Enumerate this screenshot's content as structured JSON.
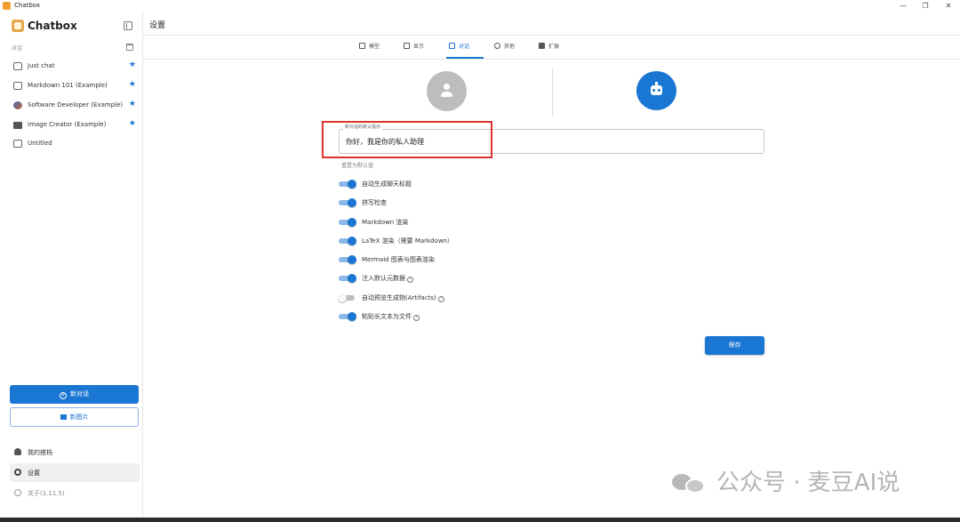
{
  "window": {
    "title": "Chatbox",
    "controls": [
      "—",
      "❐",
      "✕"
    ]
  },
  "sidebar": {
    "brand": "Chatbox",
    "section_label": "对话",
    "sessions": [
      {
        "label": "Just chat",
        "icon": "chat-bubble-icon",
        "starred": true,
        "star": "★"
      },
      {
        "label": "Markdown 101 (Example)",
        "icon": "chat-bubble-icon",
        "starred": true,
        "star": "★"
      },
      {
        "label": "Software Developer (Example)",
        "icon": "avatar-icon",
        "starred": true,
        "star": "★"
      },
      {
        "label": "Image Creator (Example)",
        "icon": "image-icon",
        "starred": true,
        "star": "★"
      },
      {
        "label": "Untitled",
        "icon": "chat-bubble-icon",
        "starred": false
      }
    ],
    "new_chat_label": "新对话",
    "new_image_label": "新图片",
    "my_copilots_label": "我的搭档",
    "settings_label": "设置",
    "about_label": "关于(1.11.5)"
  },
  "main": {
    "title": "设置",
    "tabs": [
      {
        "label": "模型",
        "icon": "model-icon",
        "active": false
      },
      {
        "label": "显示",
        "icon": "display-icon",
        "active": false
      },
      {
        "label": "对话",
        "icon": "chat-icon",
        "active": true
      },
      {
        "label": "其他",
        "icon": "gear-icon",
        "active": false
      },
      {
        "label": "扩展",
        "icon": "puzzle-icon",
        "active": false
      }
    ],
    "prompt": {
      "legend": "新对话的默认提示",
      "value": "你好，我是你的私人助理"
    },
    "reset_label": "重置为默认值",
    "toggles": [
      {
        "label": "自动生成聊天标题",
        "on": true,
        "help": false
      },
      {
        "label": "拼写检查",
        "on": true,
        "help": false
      },
      {
        "label": "Markdown 渲染",
        "on": true,
        "help": false
      },
      {
        "label": "LaTeX 渲染（需要 Markdown）",
        "on": true,
        "help": false
      },
      {
        "label": "Mermaid 图表与图表渲染",
        "on": true,
        "help": false
      },
      {
        "label": "注入默认元数据",
        "on": true,
        "help": true
      },
      {
        "label": "自动预览生成物(Artifacts)",
        "on": false,
        "help": true
      },
      {
        "label": "粘贴长文本为文件",
        "on": true,
        "help": true
      }
    ],
    "save_label": "保存",
    "help_glyph": "?"
  },
  "watermark": {
    "text": "公众号 · 麦豆AI说"
  },
  "colors": {
    "accent": "#1976d2",
    "highlight": "#e0312f"
  }
}
